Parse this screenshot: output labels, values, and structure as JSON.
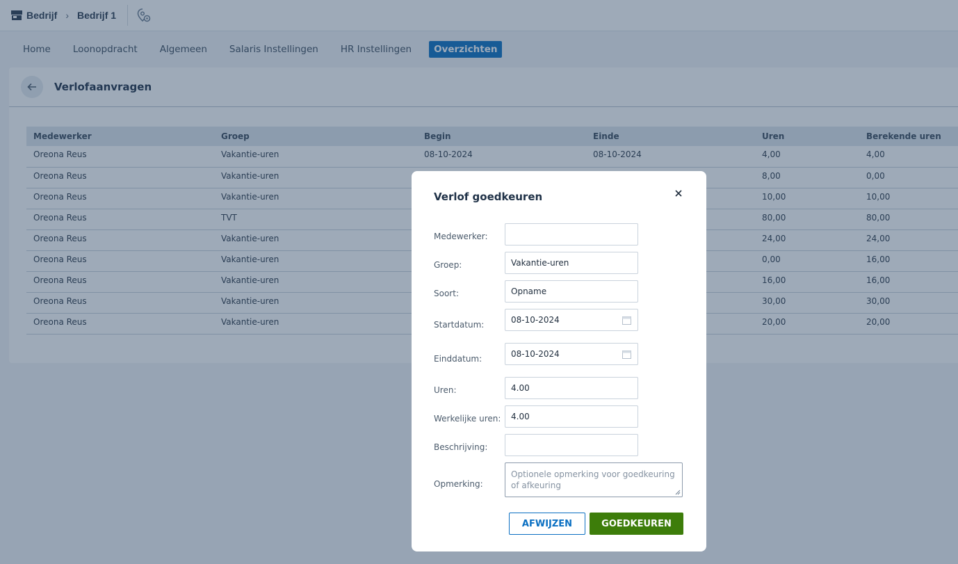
{
  "breadcrumb": {
    "root": "Bedrijf",
    "current": "Bedrijf 1"
  },
  "tabs": [
    {
      "label": "Home"
    },
    {
      "label": "Loonopdracht"
    },
    {
      "label": "Algemeen"
    },
    {
      "label": "Salaris Instellingen"
    },
    {
      "label": "HR Instellingen"
    },
    {
      "label": "Overzichten"
    }
  ],
  "page": {
    "title": "Verlofaanvragen"
  },
  "table": {
    "headers": [
      "Medewerker",
      "Groep",
      "Begin",
      "Einde",
      "Uren",
      "Berekende uren"
    ],
    "rows": [
      [
        "Oreona Reus",
        "Vakantie-uren",
        "08-10-2024",
        "08-10-2024",
        "4,00",
        "4,00"
      ],
      [
        "Oreona Reus",
        "Vakantie-uren",
        "",
        "",
        "8,00",
        "0,00"
      ],
      [
        "Oreona Reus",
        "Vakantie-uren",
        "",
        "",
        "10,00",
        "10,00"
      ],
      [
        "Oreona Reus",
        "TVT",
        "",
        "",
        "80,00",
        "80,00"
      ],
      [
        "Oreona Reus",
        "Vakantie-uren",
        "",
        "",
        "24,00",
        "24,00"
      ],
      [
        "Oreona Reus",
        "Vakantie-uren",
        "",
        "",
        "0,00",
        "16,00"
      ],
      [
        "Oreona Reus",
        "Vakantie-uren",
        "",
        "",
        "16,00",
        "16,00"
      ],
      [
        "Oreona Reus",
        "Vakantie-uren",
        "",
        "",
        "30,00",
        "30,00"
      ],
      [
        "Oreona Reus",
        "Vakantie-uren",
        "",
        "",
        "20,00",
        "20,00"
      ]
    ]
  },
  "modal": {
    "title": "Verlof goedkeuren",
    "fields": {
      "medewerker": {
        "label": "Medewerker:",
        "value": ""
      },
      "groep": {
        "label": "Groep:",
        "value": "Vakantie-uren"
      },
      "soort": {
        "label": "Soort:",
        "value": "Opname"
      },
      "startdatum": {
        "label": "Startdatum:",
        "value": "08-10-2024"
      },
      "einddatum": {
        "label": "Einddatum:",
        "value": "08-10-2024"
      },
      "uren": {
        "label": "Uren:",
        "value": "4.00"
      },
      "werkelijke_uren": {
        "label": "Werkelijke uren:",
        "value": "4.00"
      },
      "beschrijving": {
        "label": "Beschrijving:",
        "value": ""
      },
      "opmerking": {
        "label": "Opmerking:",
        "placeholder": "Optionele opmerking voor goedkeuring of afkeuring"
      }
    },
    "reject_label": "AFWIJZEN",
    "approve_label": "GOEDKEUREN"
  },
  "colors": {
    "accent": "#0a6fc2",
    "approve": "#3d7d0a",
    "overlay": "#284262"
  },
  "icons": [
    "store-icon",
    "chevron-right-icon",
    "location-settings-icon",
    "arrow-left-icon",
    "close-icon",
    "calendar-icon"
  ]
}
